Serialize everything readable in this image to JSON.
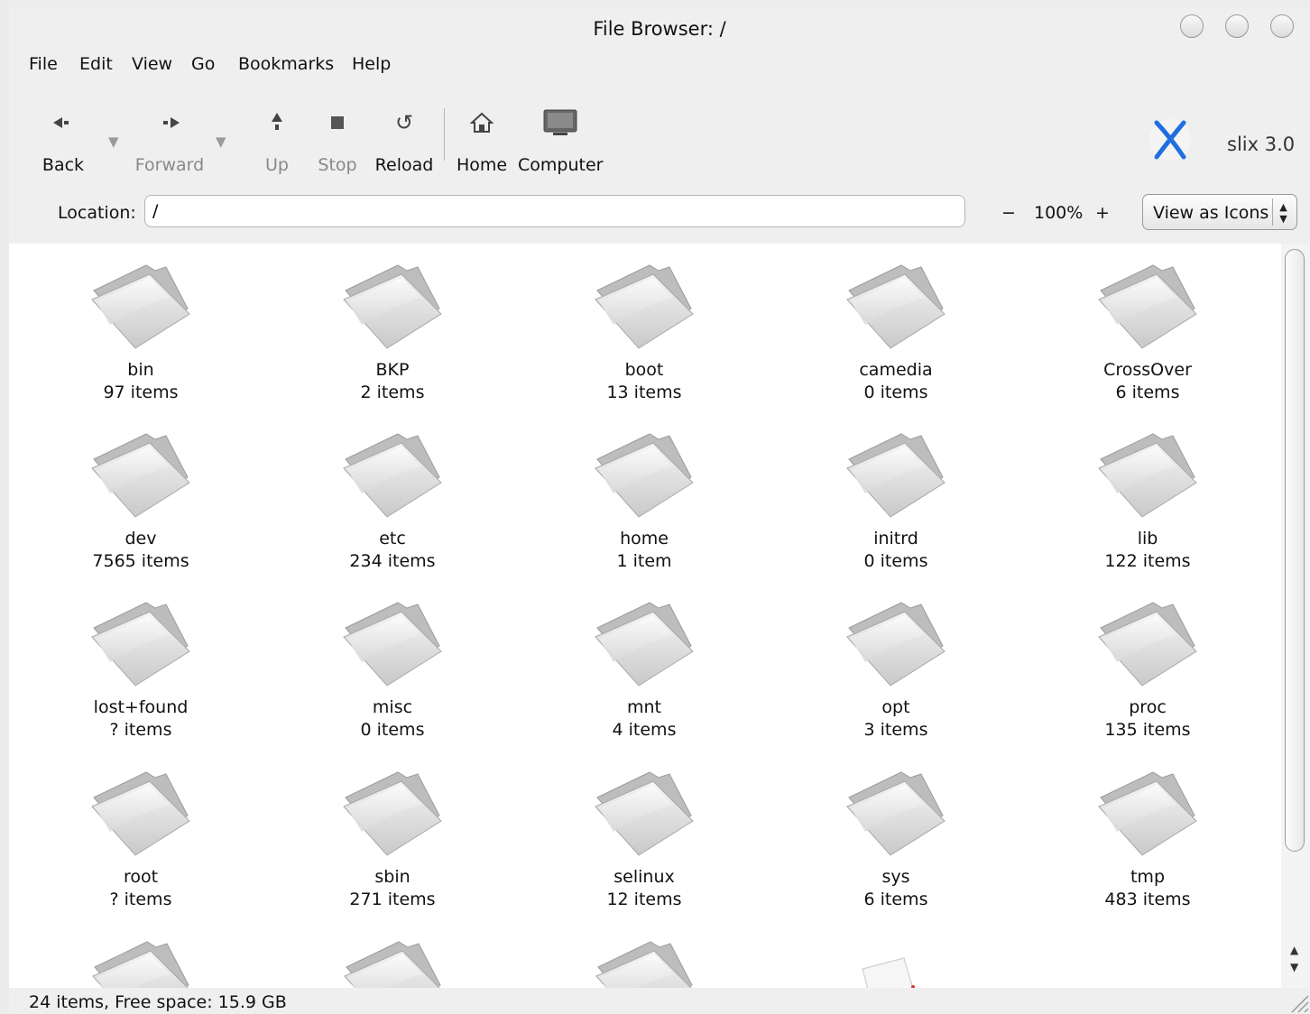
{
  "window": {
    "title": "File Browser: /"
  },
  "menu": [
    "File",
    "Edit",
    "View",
    "Go",
    "Bookmarks",
    "Help"
  ],
  "toolbar": {
    "back": "Back",
    "forward": "Forward",
    "up": "Up",
    "stop": "Stop",
    "reload": "Reload",
    "home": "Home",
    "computer": "Computer"
  },
  "brand": {
    "name": "slix 3.0"
  },
  "location": {
    "label": "Location:",
    "value": "/"
  },
  "zoom": {
    "minus": "−",
    "level": "100%",
    "plus": "+"
  },
  "view": {
    "selected": "View as Icons"
  },
  "items": [
    {
      "name": "bin",
      "count": "97 items"
    },
    {
      "name": "BKP",
      "count": "2 items"
    },
    {
      "name": "boot",
      "count": "13 items"
    },
    {
      "name": "camedia",
      "count": "0 items"
    },
    {
      "name": "CrossOver",
      "count": "6 items"
    },
    {
      "name": "dev",
      "count": "7565 items"
    },
    {
      "name": "etc",
      "count": "234 items"
    },
    {
      "name": "home",
      "count": "1 item"
    },
    {
      "name": "initrd",
      "count": "0 items"
    },
    {
      "name": "lib",
      "count": "122 items"
    },
    {
      "name": "lost+found",
      "count": "? items"
    },
    {
      "name": "misc",
      "count": "0 items"
    },
    {
      "name": "mnt",
      "count": "4 items"
    },
    {
      "name": "opt",
      "count": "3 items"
    },
    {
      "name": "proc",
      "count": "135 items"
    },
    {
      "name": "root",
      "count": "? items"
    },
    {
      "name": "sbin",
      "count": "271 items"
    },
    {
      "name": "selinux",
      "count": "12 items"
    },
    {
      "name": "sys",
      "count": "6 items"
    },
    {
      "name": "tmp",
      "count": "483 items"
    }
  ],
  "status": {
    "text": "24 items, Free space: 15.9 GB"
  }
}
